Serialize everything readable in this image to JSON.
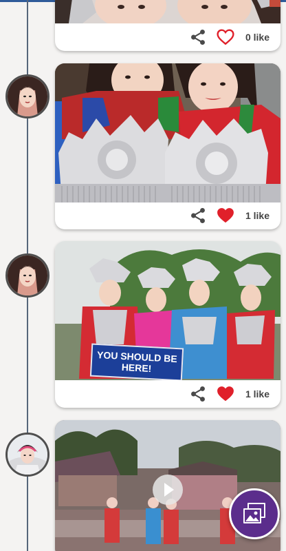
{
  "feed": {
    "posts": [
      {
        "likes_label": "0 like",
        "liked": false
      },
      {
        "likes_label": "1 like",
        "liked": true
      },
      {
        "likes_label": "1 like",
        "liked": true,
        "banner_text": "YOU SHOULD BE HERE!"
      },
      {
        "is_video": true
      }
    ]
  },
  "icons": {
    "share": "share-icon",
    "heart_empty": "heart-outline-icon",
    "heart_filled": "heart-filled-icon",
    "play": "play-icon",
    "gallery": "gallery-icon"
  },
  "colors": {
    "timeline": "#55657a",
    "heart": "#e0202a",
    "fab": "#5b2d8c",
    "top_bar": "#2f5b9a"
  }
}
